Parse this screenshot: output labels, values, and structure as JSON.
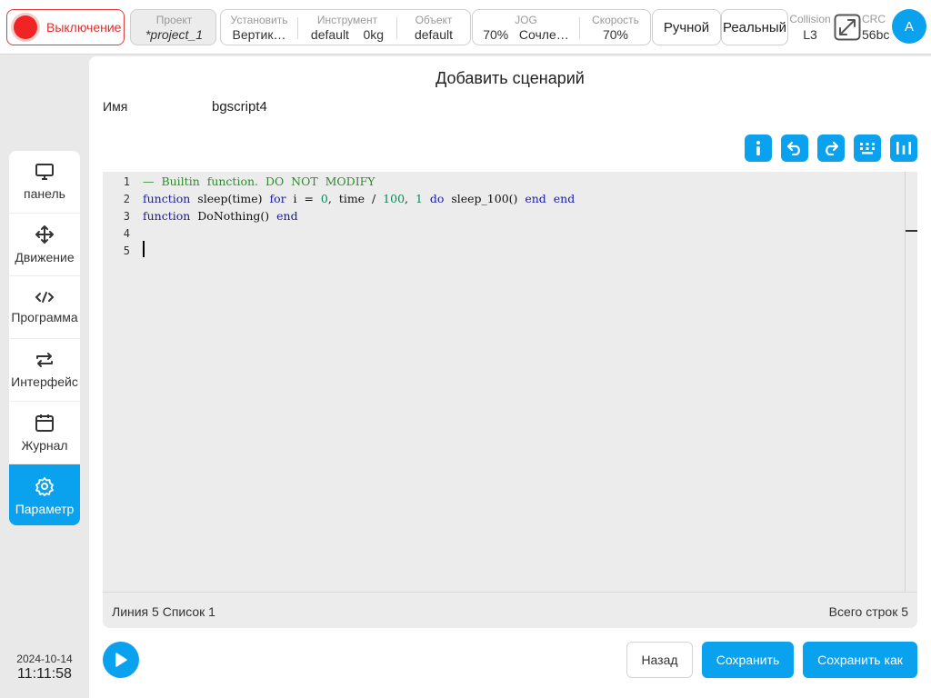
{
  "topbar": {
    "power_label": "Выключение",
    "project": {
      "title": "Проект",
      "value": "*project_1"
    },
    "install": {
      "title": "Установить",
      "value": "Вертик…"
    },
    "tool": {
      "title": "Инструмент",
      "name": "default",
      "weight": "0kg"
    },
    "object": {
      "title": "Объект",
      "value": "default"
    },
    "jog": {
      "title": "JOG",
      "percent": "70%",
      "mode": "Сочле…"
    },
    "speed": {
      "title": "Скорость",
      "value": "70%"
    },
    "manual_label": "Ручной",
    "real_label": "Реальный",
    "collision": {
      "title": "Collision",
      "value": "L3"
    },
    "crc": {
      "title": "CRC",
      "value": "56bc"
    },
    "avatar_letter": "A"
  },
  "sidebar": {
    "items": [
      {
        "label": "панель",
        "icon": "monitor-icon"
      },
      {
        "label": "Движение",
        "icon": "move-icon"
      },
      {
        "label": "Программа",
        "icon": "code-icon"
      },
      {
        "label": "Интерфейс",
        "icon": "swap-icon"
      },
      {
        "label": "Журнал",
        "icon": "calendar-icon"
      },
      {
        "label": "Параметр",
        "icon": "gear-icon",
        "active": true
      }
    ]
  },
  "datetime": {
    "date": "2024-10-14",
    "time": "11:11:58"
  },
  "dialog": {
    "title": "Добавить сценарий",
    "name_label": "Имя",
    "name_value": "bgscript4"
  },
  "editor": {
    "line_numbers": [
      "1",
      "2",
      "3",
      "4",
      "5"
    ],
    "line1": {
      "comment": "—  Builtin  function.  DO  NOT  MODIFY"
    },
    "line2": {
      "kw_function": "function",
      "text_a": "  sleep(time)  ",
      "kw_for": "for",
      "text_b": "  i  =  ",
      "n0": "0",
      "text_c": ",  time  /  ",
      "n100": "100",
      "text_d": ",  ",
      "n1": "1",
      "text_e": "  ",
      "kw_do": "do",
      "text_f": "  sleep_100()  ",
      "kw_end1": "end",
      "text_g": "  ",
      "kw_end2": "end"
    },
    "line3": {
      "kw_function": "function",
      "text_a": "  DoNothing()  ",
      "kw_end": "end"
    }
  },
  "status": {
    "left": "Линия 5 Список 1",
    "right": "Всего строк 5"
  },
  "footer": {
    "back": "Назад",
    "save": "Сохранить",
    "save_as": "Сохранить как"
  },
  "colors": {
    "accent": "#0aa1ef",
    "power": "#f02424"
  }
}
